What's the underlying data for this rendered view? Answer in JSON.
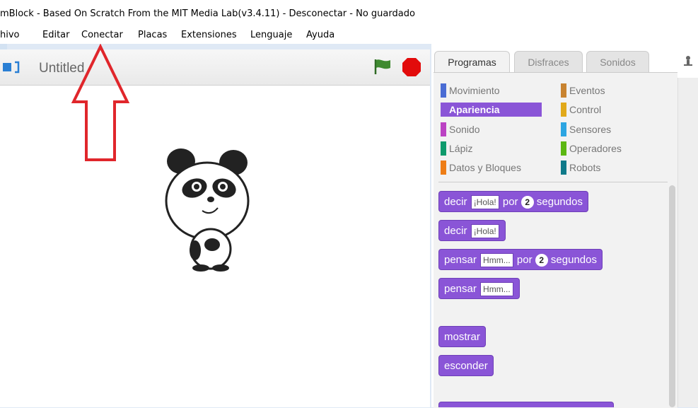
{
  "window": {
    "title": "mBlock - Based On Scratch From the MIT Media Lab(v3.4.11) - Desconectar - No guardado"
  },
  "menu": [
    "hivo",
    "Editar",
    "Conectar",
    "Placas",
    "Extensiones",
    "Lenguaje",
    "Ayuda"
  ],
  "stage": {
    "project_title": "Untitled",
    "icons": [
      "stage-mode-icon",
      "green-flag-icon",
      "stop-icon"
    ]
  },
  "tabs": [
    "Programas",
    "Disfraces",
    "Sonidos"
  ],
  "categories": {
    "left": [
      {
        "label": "Movimiento",
        "color": "#4a6cd4"
      },
      {
        "label": "Apariencia",
        "color": "#8a55d7"
      },
      {
        "label": "Sonido",
        "color": "#bb42c3"
      },
      {
        "label": "Lápiz",
        "color": "#0e9a6c"
      },
      {
        "label": "Datos y Bloques",
        "color": "#ee7d16"
      }
    ],
    "right": [
      {
        "label": "Eventos",
        "color": "#c88330"
      },
      {
        "label": "Control",
        "color": "#e1a91a"
      },
      {
        "label": "Sensores",
        "color": "#2ca5e2"
      },
      {
        "label": "Operadores",
        "color": "#5cb712"
      },
      {
        "label": "Robots",
        "color": "#0f7a8a"
      }
    ],
    "selected": "Apariencia"
  },
  "blocks": {
    "b1": {
      "a": "decir",
      "slot": "¡Hola!",
      "b": "por",
      "num": "2",
      "c": "segundos"
    },
    "b2": {
      "a": "decir",
      "slot": "¡Hola!"
    },
    "b3": {
      "a": "pensar",
      "slot": "Hmm...",
      "b": "por",
      "num": "2",
      "c": "segundos"
    },
    "b4": {
      "a": "pensar",
      "slot": "Hmm..."
    },
    "b5": {
      "a": "mostrar"
    },
    "b6": {
      "a": "esconder"
    }
  },
  "colors": {
    "accent": "#8a55d7",
    "annotation_arrow": "#e0262b"
  }
}
